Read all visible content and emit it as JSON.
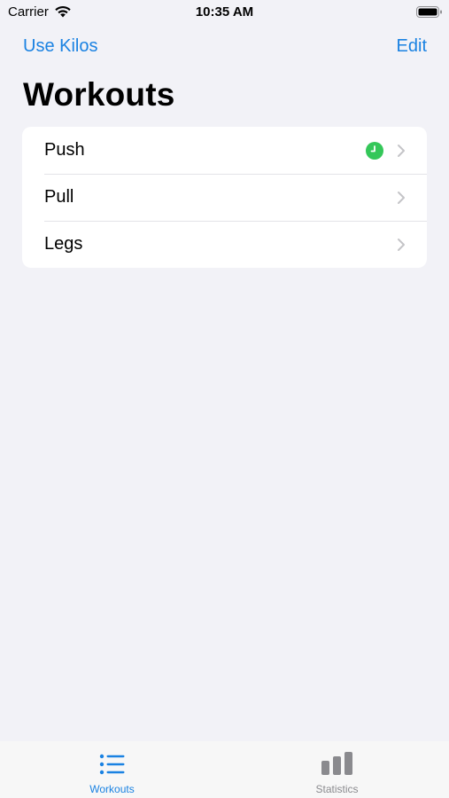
{
  "status_bar": {
    "carrier": "Carrier",
    "time": "10:35 AM"
  },
  "nav": {
    "left_button": "Use Kilos",
    "right_button": "Edit",
    "title": "Workouts"
  },
  "workouts": [
    {
      "label": "Push",
      "has_active_badge": true
    },
    {
      "label": "Pull",
      "has_active_badge": false
    },
    {
      "label": "Legs",
      "has_active_badge": false
    }
  ],
  "tab_bar": {
    "tabs": [
      {
        "label": "Workouts",
        "icon": "list-icon",
        "selected": true
      },
      {
        "label": "Statistics",
        "icon": "bar-chart-icon",
        "selected": false
      }
    ]
  },
  "colors": {
    "accent": "#1a82e2",
    "active_badge": "#34c759",
    "background": "#f2f2f7"
  }
}
